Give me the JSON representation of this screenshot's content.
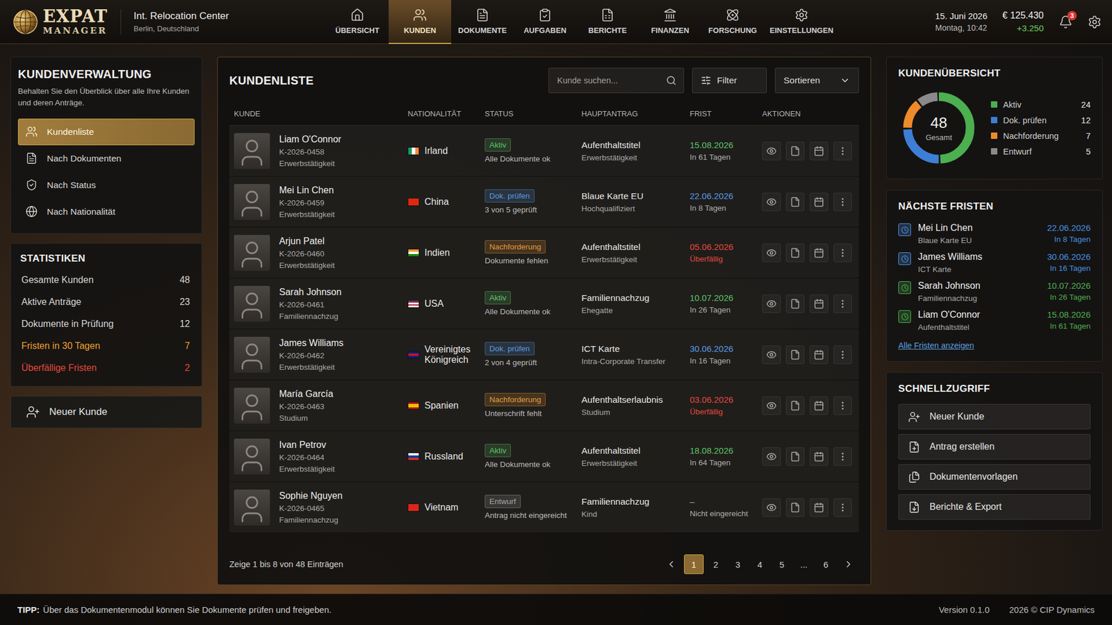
{
  "app": {
    "logo_top": "EXPAT",
    "logo_bottom": "MANAGER",
    "office": "Int. Relocation Center",
    "location": "Berlin, Deutschland"
  },
  "nav": [
    {
      "label": "ÜBERSICHT",
      "selected": false
    },
    {
      "label": "KUNDEN",
      "selected": true
    },
    {
      "label": "DOKUMENTE",
      "selected": false
    },
    {
      "label": "AUFGABEN",
      "selected": false
    },
    {
      "label": "BERICHTE",
      "selected": false
    },
    {
      "label": "FINANZEN",
      "selected": false
    },
    {
      "label": "FORSCHUNG",
      "selected": false
    },
    {
      "label": "EINSTELLUNGEN",
      "selected": false
    }
  ],
  "header": {
    "date": "15. Juni 2026",
    "time": "Montag, 10:42",
    "money": "€ 125.430",
    "money_change": "+3.250",
    "notifications": "3"
  },
  "sidebar": {
    "title": "KUNDENVERWALTUNG",
    "subtitle": "Behalten Sie den Überblick über alle Ihre Kunden und deren Anträge.",
    "items": [
      {
        "label": "Kundenliste",
        "selected": true
      },
      {
        "label": "Nach Dokumenten",
        "selected": false
      },
      {
        "label": "Nach Status",
        "selected": false
      },
      {
        "label": "Nach Nationalität",
        "selected": false
      }
    ],
    "stats_title": "STATISTIKEN",
    "stats": [
      {
        "label": "Gesamte Kunden",
        "value": "48",
        "color": "#d6d6d6"
      },
      {
        "label": "Aktive Anträge",
        "value": "23",
        "color": "#d6d6d6"
      },
      {
        "label": "Dokumente in Prüfung",
        "value": "12",
        "color": "#d6d6d6"
      },
      {
        "label": "Fristen in 30 Tagen",
        "value": "7",
        "color": "#f0a030"
      },
      {
        "label": "Überfällige Fristen",
        "value": "2",
        "color": "#e5483d"
      }
    ],
    "new_button": "Neuer Kunde"
  },
  "table": {
    "title": "KUNDENLISTE",
    "search_placeholder": "Kunde suchen...",
    "filter": "Filter",
    "sort": "Sortieren",
    "columns": [
      "KUNDE",
      "NATIONALITÄT",
      "STATUS",
      "HAUPTANTRAG",
      "FRIST",
      "AKTIONEN"
    ],
    "rows": [
      {
        "name": "Liam O'Connor",
        "id": "K-2026-0458",
        "category": "Erwerbstätigkeit",
        "nationality": "Irland",
        "flag_direction": "row",
        "flag_colors": [
          "#169b62",
          "#ffffff",
          "#ff883e"
        ],
        "status": "Aktiv",
        "status_color": "#5cc46a",
        "status_note": "Alle Dokumente ok",
        "application": "Aufenthaltstitel",
        "application_type": "Erwerbstätigkeit",
        "deadline": "15.08.2026",
        "deadline_color": "#5cc46a",
        "due_note": "In 61 Tagen",
        "due_note_color": "#b0b0b0"
      },
      {
        "name": "Mei Lin Chen",
        "id": "K-2026-0459",
        "category": "Erwerbstätigkeit",
        "nationality": "China",
        "flag_direction": "row",
        "flag_colors": [
          "#de2910"
        ],
        "status": "Dok. prüfen",
        "status_color": "#5a9be6",
        "status_note": "3 von 5 geprüft",
        "application": "Blaue Karte EU",
        "application_type": "Hochqualifiziert",
        "deadline": "22.06.2026",
        "deadline_color": "#5a9be6",
        "due_note": "In 8 Tagen",
        "due_note_color": "#b0b0b0"
      },
      {
        "name": "Arjun Patel",
        "id": "K-2026-0460",
        "category": "Erwerbstätigkeit",
        "nationality": "Indien",
        "flag_direction": "column",
        "flag_colors": [
          "#ff9933",
          "#ffffff",
          "#138808"
        ],
        "status": "Nachforderung",
        "status_color": "#e99a3a",
        "status_note": "Dokumente fehlen",
        "application": "Aufenthaltstitel",
        "application_type": "Erwerbstätigkeit",
        "deadline": "05.06.2026",
        "deadline_color": "#e5483d",
        "due_note": "Überfällig",
        "due_note_color": "#e5483d"
      },
      {
        "name": "Sarah Johnson",
        "id": "K-2026-0461",
        "category": "Familiennachzug",
        "nationality": "USA",
        "flag_direction": "column",
        "flag_colors": [
          "#3c3b6e",
          "#b22234",
          "#ffffff",
          "#b22234",
          "#ffffff"
        ],
        "status": "Aktiv",
        "status_color": "#5cc46a",
        "status_note": "Alle Dokumente ok",
        "application": "Familiennachzug",
        "application_type": "Ehegatte",
        "deadline": "10.07.2026",
        "deadline_color": "#5cc46a",
        "due_note": "In 26 Tagen",
        "due_note_color": "#b0b0b0"
      },
      {
        "name": "James Williams",
        "id": "K-2026-0462",
        "category": "Erwerbstätigkeit",
        "nationality": "Vereinigtes Königreich",
        "flag_direction": "column",
        "flag_colors": [
          "#012169",
          "#c8102e",
          "#012169"
        ],
        "status": "Dok. prüfen",
        "status_color": "#5a9be6",
        "status_note": "2 von 4 geprüft",
        "application": "ICT Karte",
        "application_type": "Intra-Corporate Transfer",
        "deadline": "30.06.2026",
        "deadline_color": "#5a9be6",
        "due_note": "In 16 Tagen",
        "due_note_color": "#b0b0b0"
      },
      {
        "name": "María García",
        "id": "K-2026-0463",
        "category": "Studium",
        "nationality": "Spanien",
        "flag_direction": "column",
        "flag_colors": [
          "#aa151b",
          "#f1bf00",
          "#f1bf00",
          "#aa151b"
        ],
        "status": "Nachforderung",
        "status_color": "#e99a3a",
        "status_note": "Unterschrift fehlt",
        "application": "Aufenthaltserlaubnis",
        "application_type": "Studium",
        "deadline": "03.06.2026",
        "deadline_color": "#e5483d",
        "due_note": "Überfällig",
        "due_note_color": "#e5483d"
      },
      {
        "name": "Ivan Petrov",
        "id": "K-2026-0464",
        "category": "Erwerbstätigkeit",
        "nationality": "Russland",
        "flag_direction": "column",
        "flag_colors": [
          "#ffffff",
          "#0039a6",
          "#d52b1e"
        ],
        "status": "Aktiv",
        "status_color": "#5cc46a",
        "status_note": "Alle Dokumente ok",
        "application": "Aufenthaltstitel",
        "application_type": "Erwerbstätigkeit",
        "deadline": "18.08.2026",
        "deadline_color": "#5cc46a",
        "due_note": "In 64 Tagen",
        "due_note_color": "#b0b0b0"
      },
      {
        "name": "Sophie Nguyen",
        "id": "K-2026-0465",
        "category": "Familiennachzug",
        "nationality": "Vietnam",
        "flag_direction": "row",
        "flag_colors": [
          "#da251d"
        ],
        "status": "Entwurf",
        "status_color": "#a8a8a8",
        "status_note": "Antrag nicht eingereicht",
        "application": "Familiennachzug",
        "application_type": "Kind",
        "deadline": "–",
        "deadline_color": "#b0b0b0",
        "due_note": "Nicht eingereicht",
        "due_note_color": "#b0b0b0"
      }
    ],
    "footer": "Zeige 1 bis 8 von 48 Einträgen",
    "pages": [
      {
        "label": "1",
        "selected": true
      },
      {
        "label": "2",
        "selected": false
      },
      {
        "label": "3",
        "selected": false
      },
      {
        "label": "4",
        "selected": false
      },
      {
        "label": "5",
        "selected": false
      },
      {
        "label": "...",
        "selected": false
      },
      {
        "label": "6",
        "selected": false
      }
    ]
  },
  "overview": {
    "title": "KUNDENÜBERSICHT",
    "total": "48",
    "total_label": "Gesamt",
    "segments": [
      {
        "label": "Aktiv",
        "value": 24,
        "count": "24",
        "color": "#4caf50"
      },
      {
        "label": "Dok. prüfen",
        "value": 12,
        "count": "12",
        "color": "#3d7fd6"
      },
      {
        "label": "Nachforderung",
        "value": 7,
        "count": "7",
        "color": "#ee8a2a"
      },
      {
        "label": "Entwurf",
        "value": 5,
        "count": "5",
        "color": "#8a8a8a"
      }
    ]
  },
  "deadlines": {
    "title": "NÄCHSTE FRISTEN",
    "items": [
      {
        "name": "Mei Lin Chen",
        "type": "Blaue Karte EU",
        "date": "22.06.2026",
        "days": "In 8 Tagen",
        "color": "#4a90e2"
      },
      {
        "name": "James Williams",
        "type": "ICT Karte",
        "date": "30.06.2026",
        "days": "In 16 Tagen",
        "color": "#4a90e2"
      },
      {
        "name": "Sarah Johnson",
        "type": "Familiennachzug",
        "date": "10.07.2026",
        "days": "In 26 Tagen",
        "color": "#4caf50"
      },
      {
        "name": "Liam O'Connor",
        "type": "Aufenthaltstitel",
        "date": "15.08.2026",
        "days": "In 61 Tagen",
        "color": "#4caf50"
      }
    ],
    "link": "Alle Fristen anzeigen"
  },
  "quick": {
    "title": "SCHNELLZUGRIFF",
    "items": [
      "Neuer Kunde",
      "Antrag erstellen",
      "Dokumentenvorlagen",
      "Berichte & Export"
    ]
  },
  "footer": {
    "tip_label": "TIPP:",
    "tip": "Über das Dokumentenmodul können Sie Dokumente prüfen und freigeben.",
    "version": "Version 0.1.0",
    "copyright": "2026 © CIP Dynamics"
  }
}
